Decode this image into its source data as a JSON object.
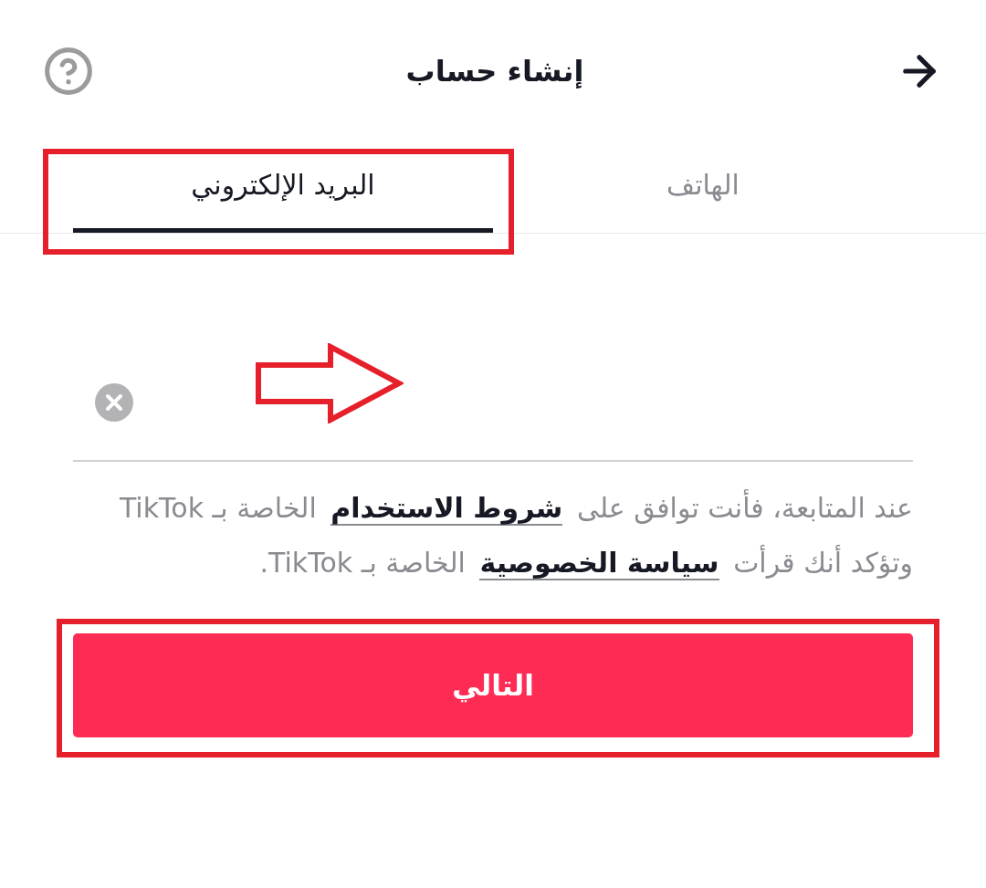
{
  "header": {
    "title": "إنشاء حساب"
  },
  "tabs": [
    {
      "label": "الهاتف",
      "selected": false,
      "highlighted": false
    },
    {
      "label": "البريد الإلكتروني",
      "selected": true,
      "highlighted": true
    }
  ],
  "terms": {
    "lines": [
      [
        {
          "kind": "text",
          "text": "عند المتابعة، فأنت توافق على"
        },
        {
          "kind": "link",
          "text": "شروط الاستخدام"
        },
        {
          "kind": "text",
          "text": "الخاصة بـ TikTok"
        }
      ],
      [
        {
          "kind": "text",
          "text": "وتؤكد أنك قرأت"
        },
        {
          "kind": "link",
          "text": "سياسة الخصوصية"
        },
        {
          "kind": "text",
          "text": "الخاصة بـ TikTok."
        }
      ]
    ]
  },
  "next_button": {
    "label": "التالي",
    "highlighted": true
  }
}
